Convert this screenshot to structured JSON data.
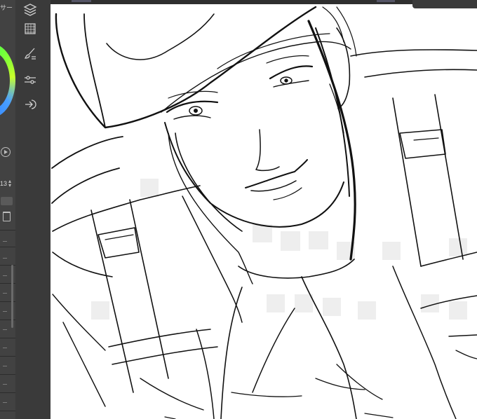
{
  "left_panel": {
    "title_fragment": "サー",
    "brush_size_value": "13"
  },
  "toolbar": {
    "icons": [
      "layers-stack-icon",
      "texture-grid-icon",
      "brush-settings-icon",
      "adjust-sliders-icon",
      "export-arrow-icon"
    ]
  },
  "canvas": {
    "background": "#ffffff",
    "content": "line-art-sketch"
  }
}
